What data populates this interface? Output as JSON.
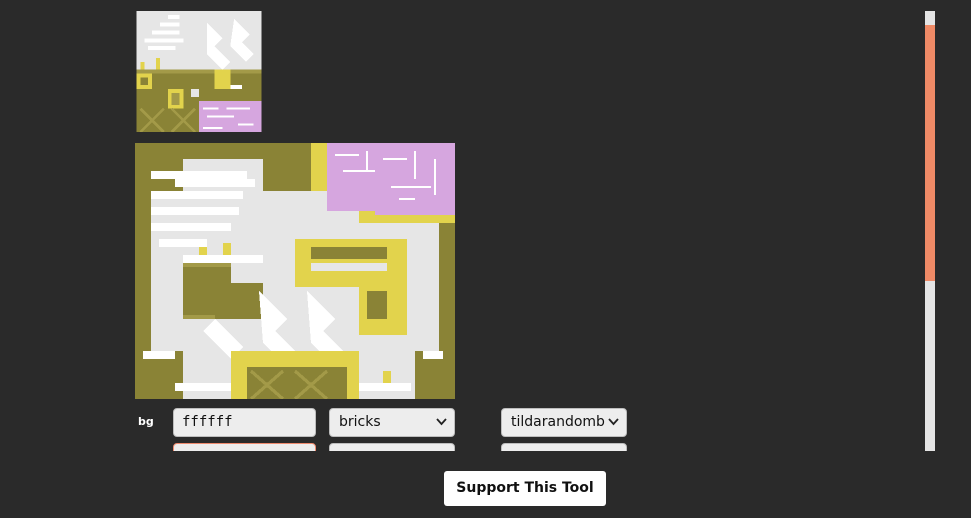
{
  "colors": {
    "page_bg": "#2a2a2a",
    "tile_floor": "#e6e6e6",
    "tile_wall": "#8a8336",
    "tile_wall_shade": "#a39a48",
    "tile_gold": "#e2d34c",
    "tile_pink": "#d6a6df",
    "tile_white": "#ffffff",
    "scroll_thumb": "#ef8a66",
    "scroll_track": "#e4e4e4",
    "error_border": "#ee8a6e"
  },
  "controls": {
    "bg": {
      "label": "bg",
      "color_value": "ffffff",
      "pattern_select": "bricks",
      "pattern_select_icon": "chevron-down-icon",
      "style_select": "tildarandomb",
      "style_select_icon": "chevron-down-icon"
    }
  },
  "support_button": "Support This Tool"
}
